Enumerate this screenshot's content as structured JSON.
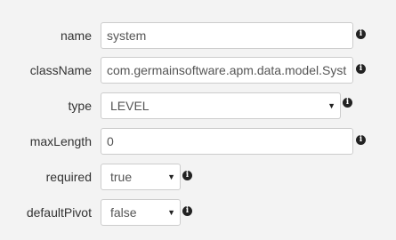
{
  "fields": [
    {
      "label": "name",
      "kind": "text",
      "value": "system",
      "info_icon": "info-icon"
    },
    {
      "label": "className",
      "kind": "text",
      "value": "com.germainsoftware.apm.data.model.Syst",
      "info_icon": "info-icon"
    },
    {
      "label": "type",
      "kind": "select",
      "value": "LEVEL",
      "info_icon": "info-icon"
    },
    {
      "label": "maxLength",
      "kind": "text",
      "value": "0",
      "info_icon": "info-icon"
    },
    {
      "label": "required",
      "kind": "select",
      "value": "true",
      "info_icon": "info-icon"
    },
    {
      "label": "defaultPivot",
      "kind": "select",
      "value": "false",
      "info_icon": "info-icon"
    }
  ],
  "icons": {
    "caret": "▼",
    "info": "i"
  }
}
